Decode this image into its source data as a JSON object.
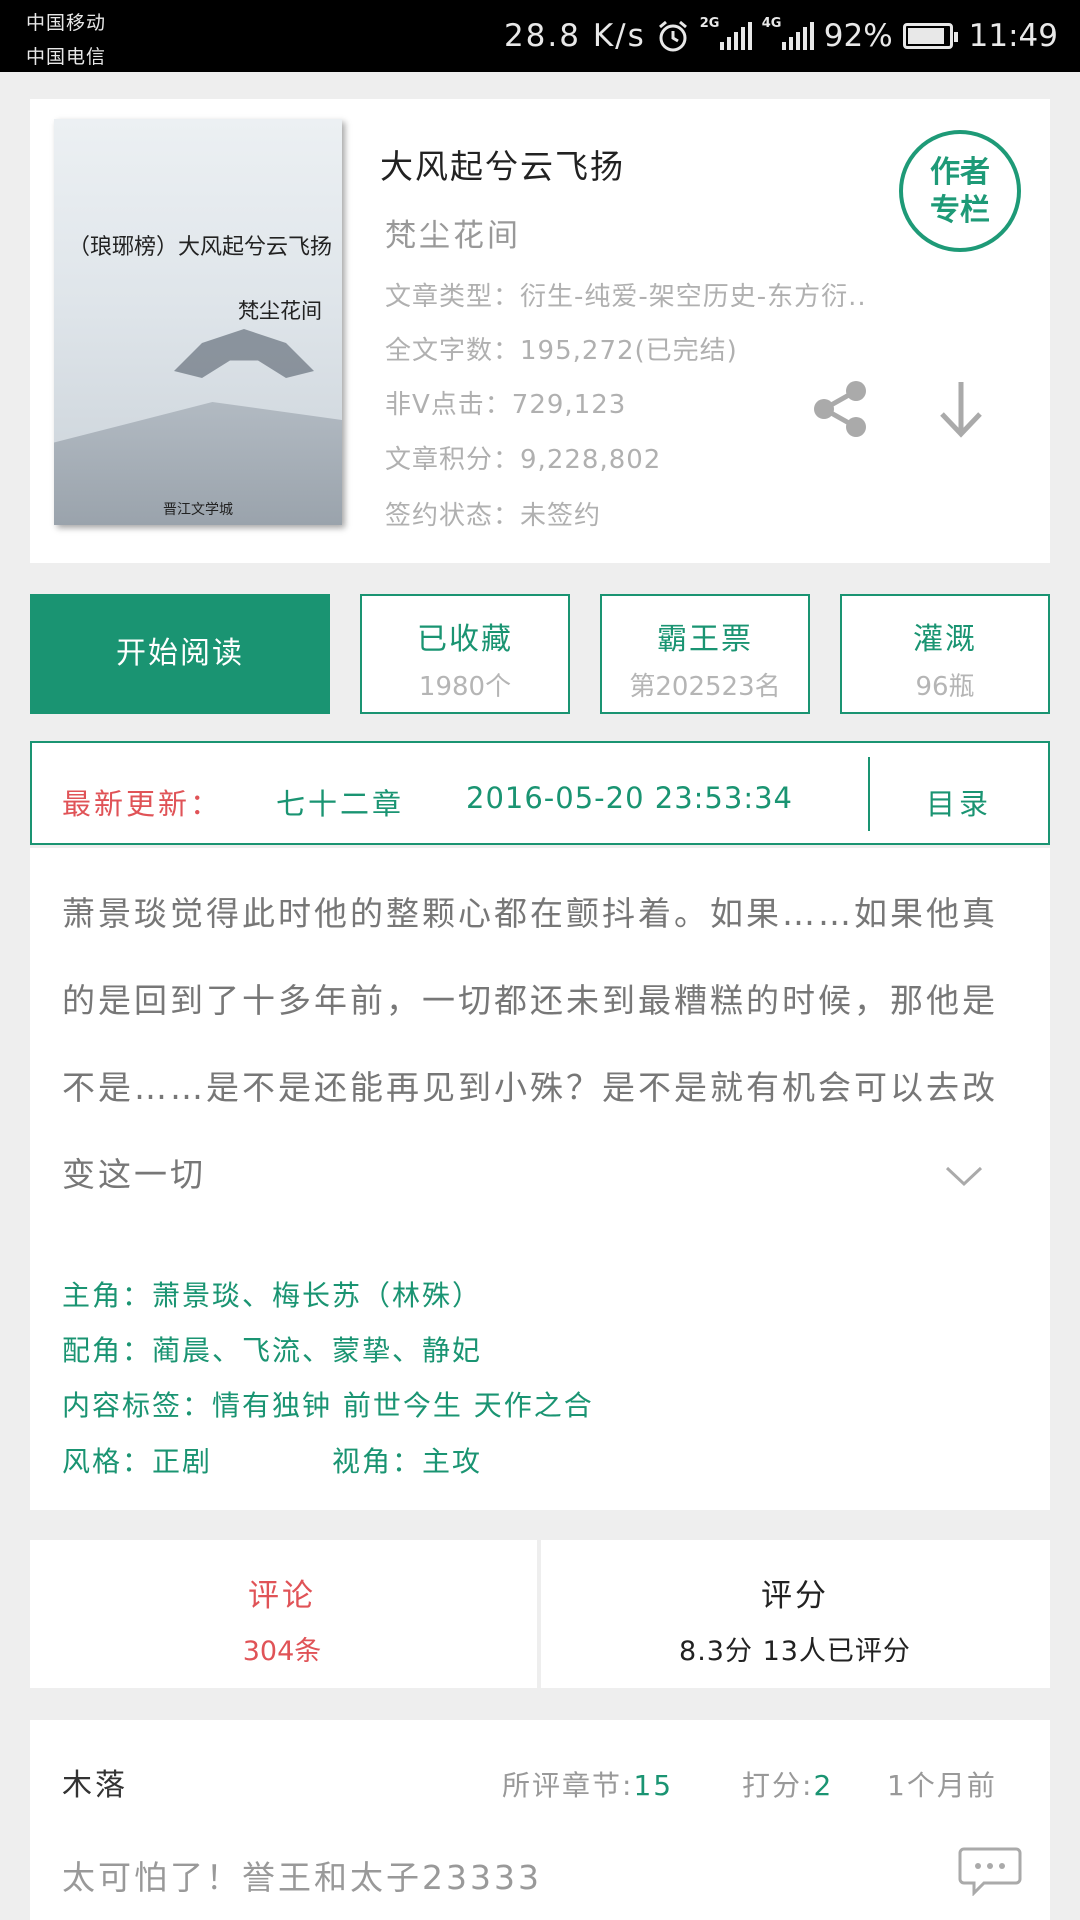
{
  "status_bar": {
    "carrier_1": "中国移动",
    "carrier_2": "中国电信",
    "net_speed": "28.8 K/s",
    "net_1": "2G",
    "net_2": "4G",
    "battery": "92%",
    "battery_level": 0.92,
    "time": "11:49"
  },
  "book": {
    "cover_title": "（琅琊榜）大风起兮云飞扬",
    "cover_author": "梵尘花间",
    "cover_footer": "晋江文学城",
    "title": "大风起兮云飞扬",
    "author": "梵尘花间",
    "author_badge_1": "作者",
    "author_badge_2": "专栏",
    "type_label": "文章类型：",
    "type_value": "衍生-纯爱-架空历史-东方衍..",
    "words_label": "全文字数：",
    "words_value": "195,272(已完结)",
    "clicks_label": "非V点击：",
    "clicks_value": "729,123",
    "score_label": "文章积分：",
    "score_value": "9,228,802",
    "sign_label": "签约状态：",
    "sign_value": "未签约"
  },
  "actions": {
    "read": "开始阅读",
    "collect": {
      "label": "已收藏",
      "sub": "1980个"
    },
    "ticket": {
      "label": "霸王票",
      "sub": "第202523名"
    },
    "water": {
      "label": "灌溉",
      "sub": "96瓶"
    }
  },
  "latest": {
    "label": "最新更新：",
    "chapter": "七十二章",
    "time": "2016-05-20 23:53:34",
    "toc": "目录"
  },
  "summary": "萧景琰觉得此时他的整颗心都在颤抖着。如果……如果他真的是回到了十多年前，一切都还未到最糟糕的时候，那他是不是……是不是还能再见到小殊？是不是就有机会可以去改变这一切",
  "tags": {
    "lead": "主角：萧景琰、梅长苏（林殊）",
    "support": "配角：蔺晨、飞流、蒙挚、静妃",
    "content": "内容标签：情有独钟 前世今生 天作之合",
    "style": "风格：正剧",
    "view": "视角：主攻"
  },
  "reviews": {
    "comment_label": "评论",
    "comment_count": "304条",
    "rating_label": "评分",
    "rating_value": "8.3分 13人已评分"
  },
  "comment": {
    "user": "木落",
    "chapter_label": "所评章节:",
    "chapter_value": "15",
    "score_label": "打分:",
    "score_value": "2",
    "time": "1个月前",
    "text": "太可怕了！誉王和太子23333"
  },
  "colors": {
    "accent": "#1a9472",
    "red": "#e05357"
  },
  "icons": [
    "alarm-icon",
    "signal-icon",
    "battery-icon",
    "share-icon",
    "download-icon",
    "chevron-down-icon",
    "comment-bubble-icon"
  ]
}
